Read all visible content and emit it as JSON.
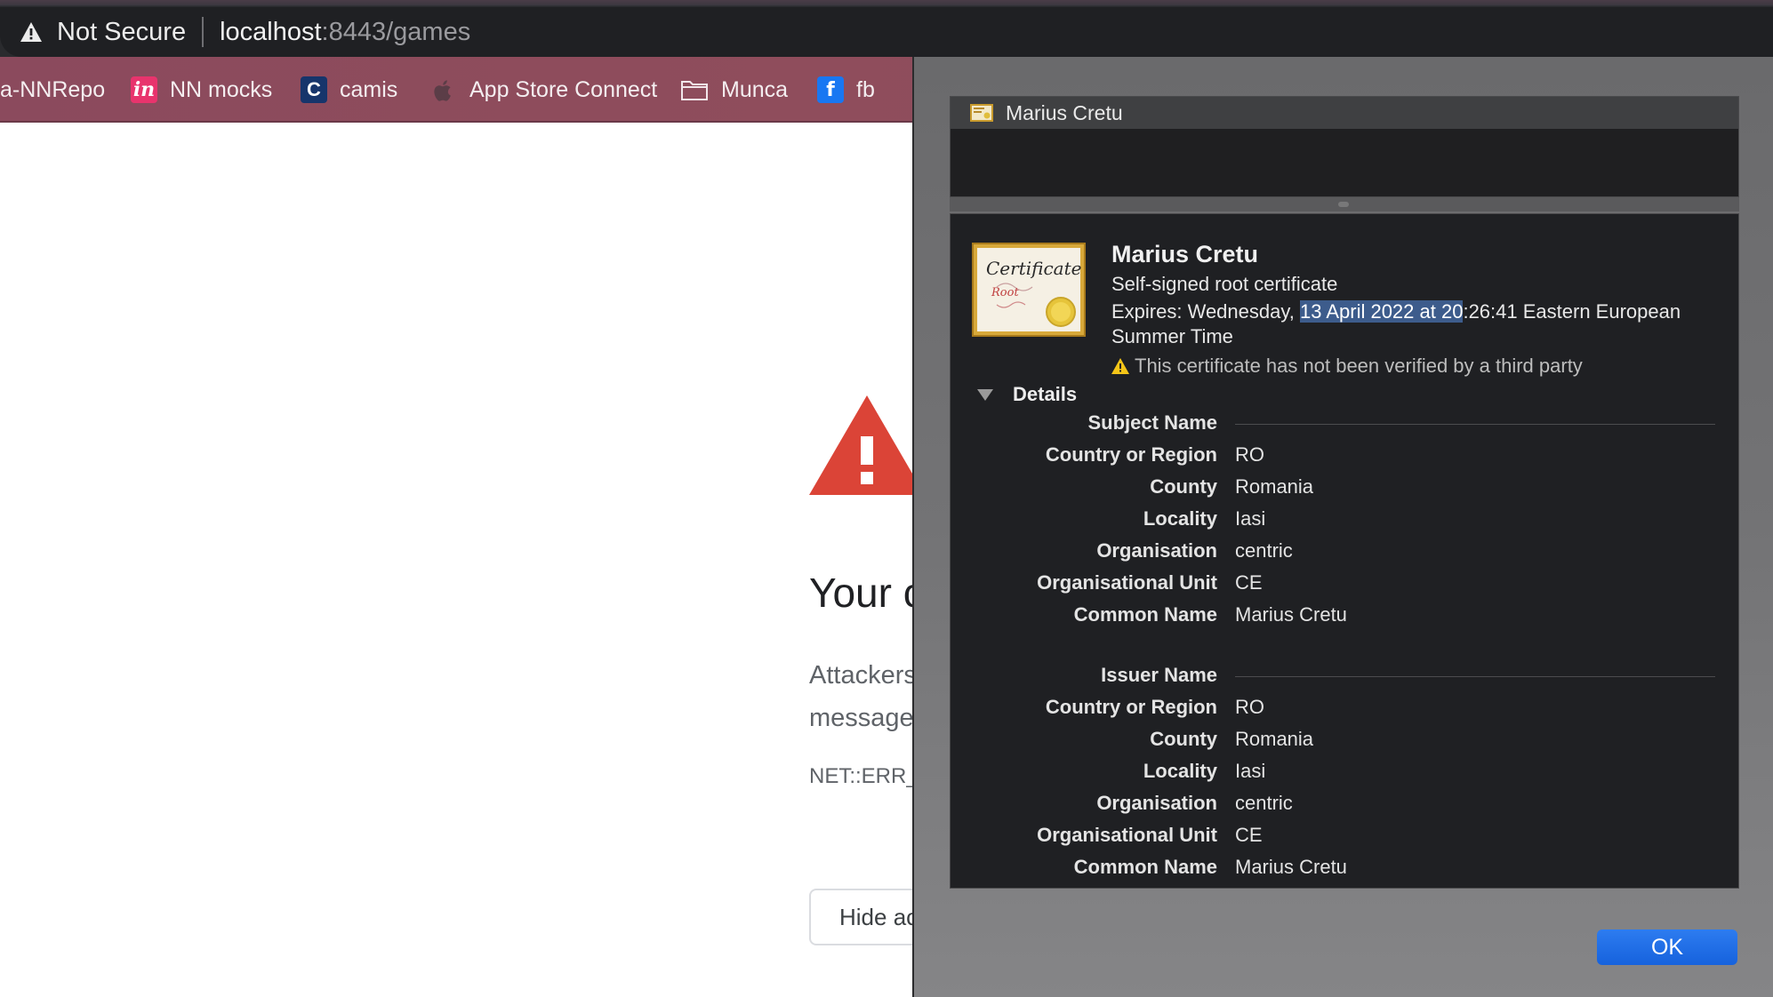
{
  "browser": {
    "security_label": "Not Secure",
    "url_host": "localhost",
    "url_path": ":8443/games"
  },
  "bookmarks": [
    {
      "label": "a-NNRepo",
      "icon": "none"
    },
    {
      "label": "NN mocks",
      "icon": "invision-icon"
    },
    {
      "label": "camis",
      "icon": "c-logo-icon"
    },
    {
      "label": "App Store Connect",
      "icon": "apple-icon"
    },
    {
      "label": "Munca",
      "icon": "folder-icon"
    },
    {
      "label": "fb",
      "icon": "facebook-icon"
    }
  ],
  "page": {
    "heading": "Your c",
    "para_line1": "Attackers",
    "para_line2": "message",
    "error_code": "NET::ERR_",
    "hide_button": "Hide ac"
  },
  "certificate": {
    "list_item": "Marius Cretu",
    "title": "Marius Cretu",
    "subtitle": "Self-signed root certificate",
    "expires_prefix": "Expires: Wednesday, ",
    "expires_highlight": "13 April 2022 at 20",
    "expires_rest": ":26:41 Eastern European Summer Time",
    "warning": "This certificate has not been verified by a third party",
    "details_label": "Details",
    "cert_image_text": "Certificate",
    "cert_image_subtext": "Root",
    "subject": {
      "section_label": "Subject Name",
      "rows": [
        {
          "key": "Country or Region",
          "value": "RO"
        },
        {
          "key": "County",
          "value": "Romania"
        },
        {
          "key": "Locality",
          "value": "Iasi"
        },
        {
          "key": "Organisation",
          "value": "centric"
        },
        {
          "key": "Organisational Unit",
          "value": "CE"
        },
        {
          "key": "Common Name",
          "value": "Marius Cretu"
        }
      ]
    },
    "issuer": {
      "section_label": "Issuer Name",
      "rows": [
        {
          "key": "Country or Region",
          "value": "RO"
        },
        {
          "key": "County",
          "value": "Romania"
        },
        {
          "key": "Locality",
          "value": "Iasi"
        },
        {
          "key": "Organisation",
          "value": "centric"
        },
        {
          "key": "Organisational Unit",
          "value": "CE"
        },
        {
          "key": "Common Name",
          "value": "Marius Cretu"
        }
      ]
    },
    "ok_button": "OK"
  },
  "colors": {
    "bookmark_bar": "#8b4a5d",
    "error_red": "#db4437",
    "selection_highlight": "#3d5c8c",
    "ok_button": "#1a6ae6"
  }
}
